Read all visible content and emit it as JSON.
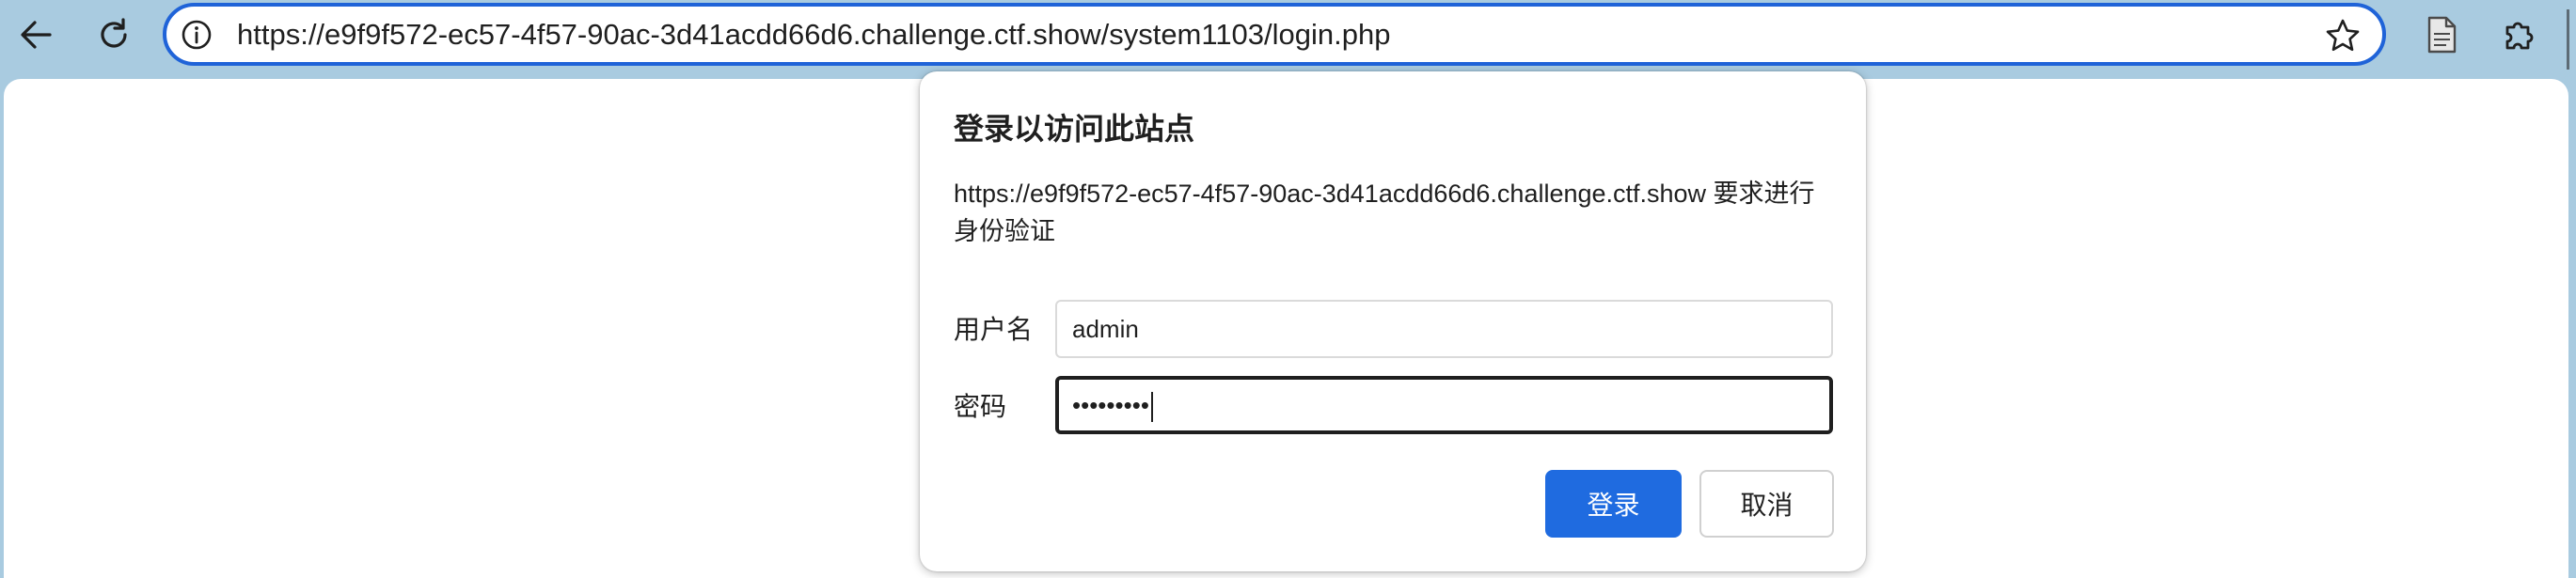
{
  "browser": {
    "url": "https://e9f9f572-ec57-4f57-90ac-3d41acdd66d6.challenge.ctf.show/system1103/login.php",
    "icons": {
      "back": "back-arrow-icon",
      "reload": "reload-icon",
      "site_info": "info-icon",
      "favorite": "star-icon",
      "reading": "document-icon",
      "extensions": "puzzle-icon"
    }
  },
  "dialog": {
    "title": "登录以访问此站点",
    "message": "https://e9f9f572-ec57-4f57-90ac-3d41acdd66d6.challenge.ctf.show 要求进行身份验证",
    "username_label": "用户名",
    "username_value": "admin",
    "password_label": "密码",
    "password_value": "•••••••••",
    "login_button": "登录",
    "cancel_button": "取消"
  },
  "colors": {
    "frame": "#a9cbe0",
    "address_focus": "#1f63d8",
    "primary_button": "#1f6be0"
  }
}
